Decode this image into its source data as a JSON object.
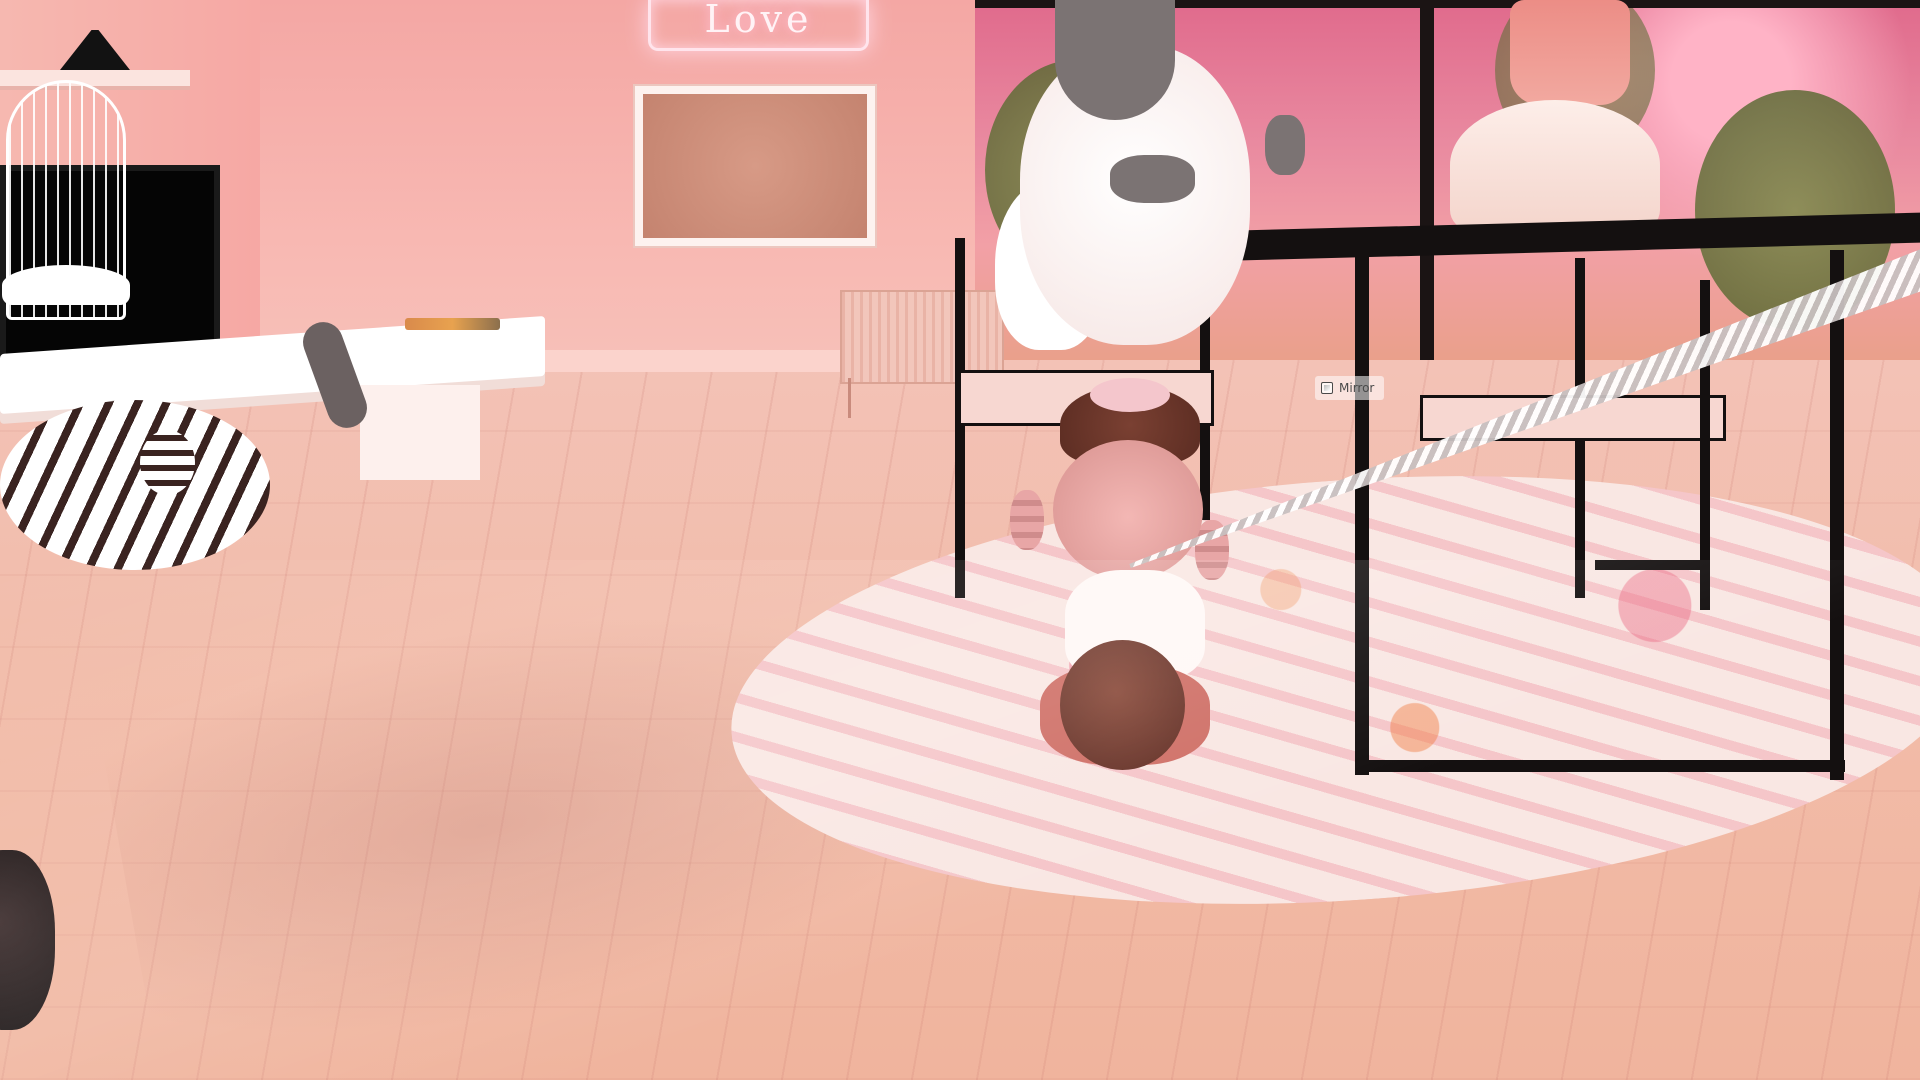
{
  "scene": {
    "neon_sign_text": "Love",
    "mirror_button_label": "Mirror",
    "mirror_button_icon": "mirror-icon"
  },
  "colors": {
    "wall": "#f6a8a4",
    "floor": "#f2bca9",
    "rug": "#f9e7e3",
    "furniture_frame": "#141010",
    "neon_glow": "#ffd6e2"
  }
}
